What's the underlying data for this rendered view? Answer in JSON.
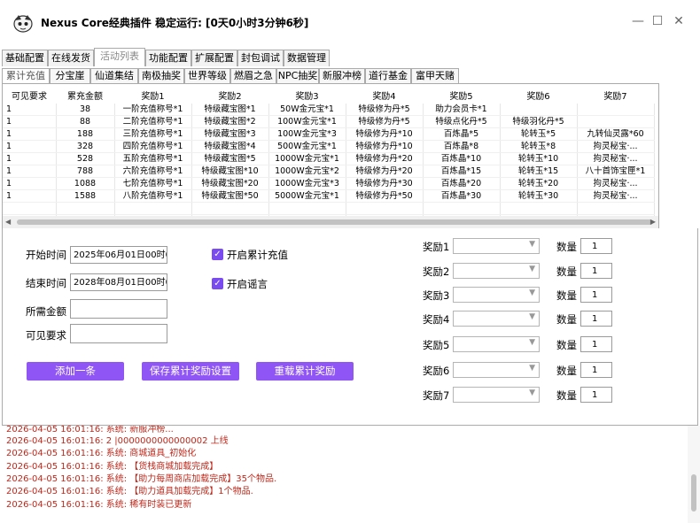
{
  "window": {
    "title": "Nexus Core经典插件  稳定运行: [0天0小时3分钟6秒]",
    "minimize": "—",
    "maximize": "☐",
    "close": "✕"
  },
  "outer_tabs": [
    "基础配置",
    "在线发货",
    "活动列表",
    "功能配置",
    "扩展配置",
    "封包调试",
    "数据管理"
  ],
  "inner_tabs": [
    "累计充值",
    "分宝崖",
    "仙道集结",
    "南极抽奖",
    "世界等级",
    "燃眉之急",
    "NPC抽奖",
    "新服冲榜",
    "道行基金",
    "富甲天赌"
  ],
  "table": {
    "columns": [
      "可见要求",
      "累充金额",
      "奖励1",
      "奖励2",
      "奖励3",
      "奖励4",
      "奖励5",
      "奖励6",
      "奖励7"
    ],
    "rows": [
      [
        "1",
        "38",
        "一阶充值称号*1",
        "特级藏宝图*1",
        "50W金元宝*1",
        "特级修为丹*5",
        "助力会员卡*1",
        "",
        ""
      ],
      [
        "1",
        "88",
        "二阶充值称号*1",
        "特级藏宝图*2",
        "100W金元宝*1",
        "特级修为丹*5",
        "特级点化丹*5",
        "特级羽化丹*5",
        ""
      ],
      [
        "1",
        "188",
        "三阶充值称号*1",
        "特级藏宝图*3",
        "100W金元宝*3",
        "特级修为丹*10",
        "百炼晶*5",
        "轮转玉*5",
        "九转仙灵露*60"
      ],
      [
        "1",
        "328",
        "四阶充值称号*1",
        "特级藏宝图*4",
        "500W金元宝*1",
        "特级修为丹*10",
        "百炼晶*8",
        "轮转玉*8",
        "拘灵秘宝·..."
      ],
      [
        "1",
        "528",
        "五阶充值称号*1",
        "特级藏宝图*5",
        "1000W金元宝*1",
        "特级修为丹*20",
        "百炼晶*10",
        "轮转玉*10",
        "拘灵秘宝·..."
      ],
      [
        "1",
        "788",
        "六阶充值称号*1",
        "特级藏宝图*10",
        "1000W金元宝*2",
        "特级修为丹*20",
        "百炼晶*15",
        "轮转玉*15",
        "八十首饰宝匣*1"
      ],
      [
        "1",
        "1088",
        "七阶充值称号*1",
        "特级藏宝图*20",
        "1000W金元宝*3",
        "特级修为丹*30",
        "百炼晶*20",
        "轮转玉*20",
        "拘灵秘宝·..."
      ],
      [
        "1",
        "1588",
        "八阶充值称号*1",
        "特级藏宝图*50",
        "5000W金元宝*1",
        "特级修为丹*50",
        "百炼晶*30",
        "轮转玉*30",
        "拘灵秘宝·..."
      ]
    ]
  },
  "form": {
    "start_label": "开始时间",
    "start_value": "2025年06月01日00时00",
    "end_label": "结束时间",
    "end_value": "2028年08月01日00时00",
    "amount_label": "所需金额",
    "amount_value": "",
    "visible_label": "可见要求",
    "visible_value": "",
    "enable_recharge": "开启累计充值",
    "enable_rumor": "开启谣言",
    "add_button": "添加一条",
    "save_button": "保存累计奖励设置",
    "reload_button": "重载累计奖励",
    "quantity_label": "数量",
    "rewards": [
      {
        "label": "奖励1",
        "qty": "1"
      },
      {
        "label": "奖励2",
        "qty": "1"
      },
      {
        "label": "奖励3",
        "qty": "1"
      },
      {
        "label": "奖励4",
        "qty": "1"
      },
      {
        "label": "奖励5",
        "qty": "1"
      },
      {
        "label": "奖励6",
        "qty": "1"
      },
      {
        "label": "奖励7",
        "qty": "1"
      }
    ]
  },
  "log": [
    "2026-04-05  16:01:16:   2 |0000000000000002    上线",
    "2026-04-05  16:01:16:   系统: 商城道具_初始化",
    "2026-04-05  16:01:16:   系统: 【货栈商城加载完成】",
    "2026-04-05  16:01:16:   系统: 【助力每周商店加载完成】35个物品.",
    "2026-04-05  16:01:16:   系统: 【助力道具加载完成】1个物品.",
    "2026-04-05  16:01:16:   系统: 稀有时装已更新"
  ],
  "colors": {
    "accent": "#9055f5",
    "log_text": "#c0271a"
  }
}
